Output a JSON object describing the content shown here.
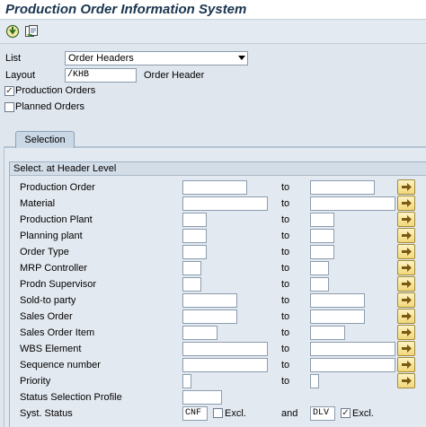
{
  "window": {
    "title": "Production Order Information System"
  },
  "toolbar": {
    "execute_icon": "execute-icon",
    "variant_icon": "get-variant-icon"
  },
  "header": {
    "list_label": "List",
    "list_value": "Order Headers",
    "layout_label": "Layout",
    "layout_value": "/KHB",
    "layout_desc": "Order Header",
    "production_orders_label": "Production Orders",
    "production_orders_checked": true,
    "planned_orders_label": "Planned Orders",
    "planned_orders_checked": false
  },
  "tabs": [
    {
      "label": "Selection"
    }
  ],
  "group": {
    "title": "Select. at Header Level"
  },
  "to_label": "to",
  "and_label": "and",
  "rows": [
    {
      "label": "Production Order",
      "from": "",
      "to": ""
    },
    {
      "label": "Material",
      "from": "",
      "to": ""
    },
    {
      "label": "Production Plant",
      "from": "",
      "to": ""
    },
    {
      "label": "Planning plant",
      "from": "",
      "to": ""
    },
    {
      "label": "Order Type",
      "from": "",
      "to": ""
    },
    {
      "label": "MRP Controller",
      "from": "",
      "to": ""
    },
    {
      "label": "Prodn Supervisor",
      "from": "",
      "to": ""
    },
    {
      "label": "Sold-to party",
      "from": "",
      "to": ""
    },
    {
      "label": "Sales Order",
      "from": "",
      "to": ""
    },
    {
      "label": "Sales Order Item",
      "from": "",
      "to": ""
    },
    {
      "label": "WBS Element",
      "from": "",
      "to": ""
    },
    {
      "label": "Sequence number",
      "from": "",
      "to": ""
    },
    {
      "label": "Priority",
      "from": "",
      "to": ""
    },
    {
      "label": "Status Selection Profile",
      "from": ""
    }
  ],
  "syst_status": {
    "label": "Syst. Status",
    "value1": "CNF",
    "excl1_label": "Excl.",
    "excl1_checked": false,
    "value2": "DLV",
    "excl2_label": "Excl.",
    "excl2_checked": true
  },
  "colors": {
    "background": "#dfe6ee",
    "title": "#1a3550",
    "multi_button": "#f3d77a"
  }
}
